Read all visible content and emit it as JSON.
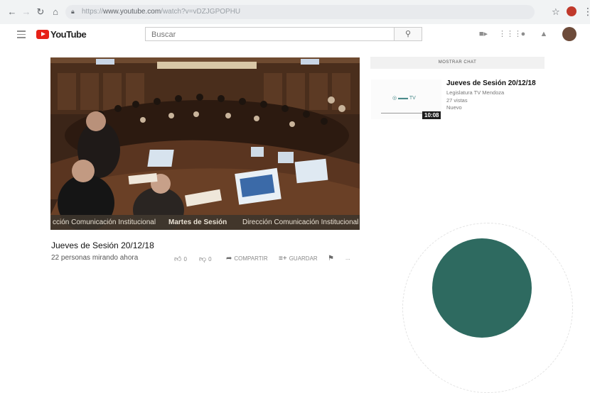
{
  "browser": {
    "url_prefix": "https://",
    "url_host": "www.youtube.com",
    "url_path": "/watch?v=vDZJGPOPHU",
    "icons": {
      "back": "arrow-left-icon",
      "forward": "arrow-right-icon",
      "reload": "reload-icon",
      "home": "home-icon",
      "lock": "lock-icon",
      "bookmark": "star-icon",
      "menu": "kebab-icon"
    }
  },
  "header": {
    "logo_text": "YouTube",
    "search_placeholder": "Buscar",
    "icons": [
      "menu-icon",
      "search-icon",
      "create-video-icon",
      "apps-icon",
      "messages-icon",
      "notifications-icon",
      "avatar-icon"
    ]
  },
  "player": {
    "caption_left": "cción Comunicación Institucional",
    "caption_center": "Martes de Sesión",
    "caption_right": "Dirección Comunicación Institucional"
  },
  "video": {
    "title": "Jueves de Sesión 20/12/18",
    "viewers": "22 personas mirando ahora",
    "likes": "0",
    "dislikes": "0",
    "share_label": "COMPARTIR",
    "save_label": "GUARDAR",
    "more_label": "..."
  },
  "sidebar": {
    "chat_button": "MOSTRAR CHAT",
    "related": {
      "title": "Jueves de Sesión 20/12/18",
      "channel": "Legislatura TV Mendoza",
      "views": "27 vistas",
      "badge": "Nuevo",
      "duration": "10:08",
      "thumb_mark": "◎ ▬▬ TV"
    }
  },
  "colors": {
    "youtube_red": "#e62117",
    "accent_teal": "#2e6a60"
  }
}
